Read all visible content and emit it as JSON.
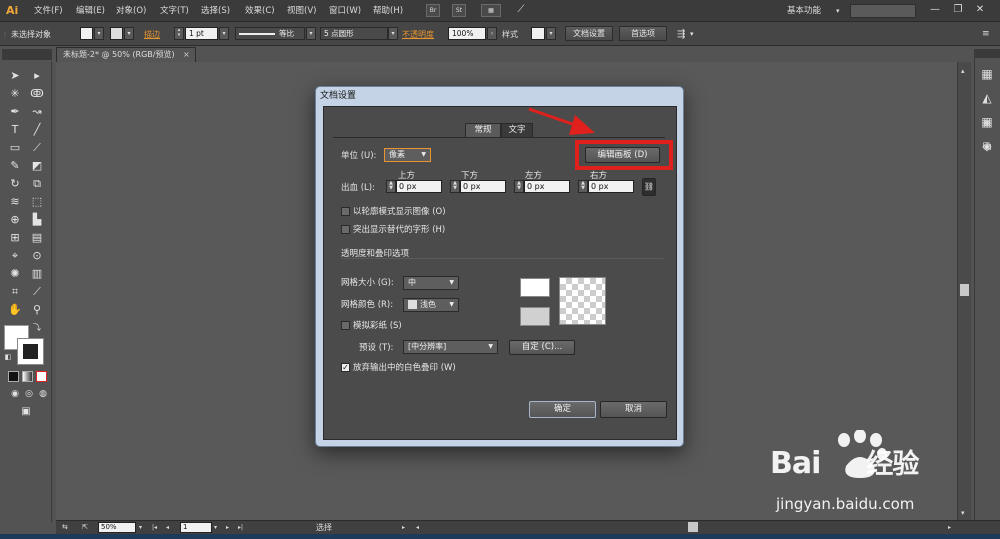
{
  "menu": {
    "app_logo": "Ai",
    "items": [
      "文件(F)",
      "编辑(E)",
      "对象(O)",
      "文字(T)",
      "选择(S)",
      "效果(C)",
      "视图(V)",
      "窗口(W)",
      "帮助(H)"
    ],
    "br_button": "Br",
    "st_button": "St",
    "workspace": "基本功能",
    "window_controls": [
      "—",
      "❐",
      "✕"
    ]
  },
  "control_bar": {
    "selection_status": "未选择对象",
    "stroke_label": "描边",
    "stroke_value": "1 pt",
    "profile_label": "等比",
    "brush_label": "5 点圆形",
    "opacity_label": "不透明度",
    "opacity_value": "100%",
    "style_label": "样式",
    "doc_setup_button": "文档设置",
    "prefs_button": "首选项"
  },
  "document_tab": {
    "title": "未标题-2* @ 50% (RGB/预览)",
    "close": "×"
  },
  "status_bar": {
    "zoom": "50%",
    "artboard": "1",
    "tool_status": "选择"
  },
  "dialog": {
    "title": "文档设置",
    "tabs": {
      "general": "常规",
      "text": "文字"
    },
    "units_label": "单位 (U):",
    "units_value": "像素",
    "edit_artboards_button": "编辑画板 (D)",
    "bleed_label": "出血 (L):",
    "bleed": {
      "top_label": "上方",
      "top_value": "0 px",
      "bottom_label": "下方",
      "bottom_value": "0 px",
      "left_label": "左方",
      "left_value": "0 px",
      "right_label": "右方",
      "right_value": "0 px"
    },
    "show_images_outline": "以轮廓模式显示图像 (O)",
    "highlight_glyphs": "突出显示替代的字形 (H)",
    "transparency_section": "透明度和叠印选项",
    "grid_size_label": "网格大小 (G):",
    "grid_size_value": "中",
    "grid_colors_label": "网格颜色 (R):",
    "grid_colors_value": "浅色",
    "simulate_paper": "模拟彩纸 (S)",
    "preset_label": "预设 (T):",
    "preset_value": "[中分辨率]",
    "custom_button": "自定 (C)...",
    "discard_white_overprint": "放弃输出中的白色叠印 (W)",
    "ok_button": "确定",
    "cancel_button": "取消"
  },
  "watermark": {
    "brand": "Bai",
    "brand_suffix": "经验",
    "url": "jingyan.baidu.com"
  },
  "colors": {
    "accent_orange": "#e8952d",
    "highlight_red": "#e0201c",
    "dialog_frame": "#c4d4e6"
  }
}
